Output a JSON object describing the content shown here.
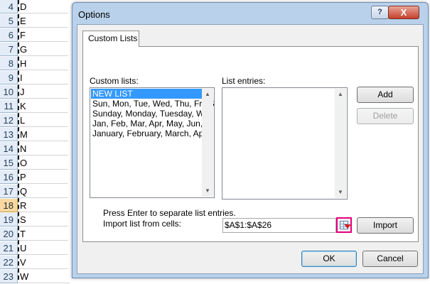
{
  "sheet": {
    "rows": [
      {
        "num": "4",
        "value": "D"
      },
      {
        "num": "5",
        "value": "E"
      },
      {
        "num": "6",
        "value": "F"
      },
      {
        "num": "7",
        "value": "G"
      },
      {
        "num": "8",
        "value": "H"
      },
      {
        "num": "9",
        "value": "I"
      },
      {
        "num": "10",
        "value": "J"
      },
      {
        "num": "11",
        "value": "K"
      },
      {
        "num": "12",
        "value": "L"
      },
      {
        "num": "13",
        "value": "M"
      },
      {
        "num": "14",
        "value": "N"
      },
      {
        "num": "15",
        "value": "O"
      },
      {
        "num": "16",
        "value": "P"
      },
      {
        "num": "17",
        "value": "Q"
      },
      {
        "num": "18",
        "value": "R"
      },
      {
        "num": "19",
        "value": "S"
      },
      {
        "num": "20",
        "value": "T"
      },
      {
        "num": "21",
        "value": "U"
      },
      {
        "num": "22",
        "value": "V"
      },
      {
        "num": "23",
        "value": "W"
      }
    ],
    "active_row": "18"
  },
  "dialog": {
    "title": "Options",
    "help_glyph": "?",
    "close_glyph": "X",
    "tab_label": "Custom Lists",
    "custom_lists_label": "Custom lists:",
    "custom_lists": [
      "NEW LIST",
      "Sun, Mon, Tue, Wed, Thu, Fri, S",
      "Sunday, Monday, Tuesday, Wed",
      "Jan, Feb, Mar, Apr, May, Jun, J",
      "January, February, March, April"
    ],
    "list_entries_label": "List entries:",
    "add_label": "Add",
    "delete_label": "Delete",
    "hint_text": "Press Enter to separate list entries.",
    "import_label": "Import list from cells:",
    "import_value": "$A$1:$A$26",
    "import_button": "Import",
    "ok_label": "OK",
    "cancel_label": "Cancel"
  }
}
